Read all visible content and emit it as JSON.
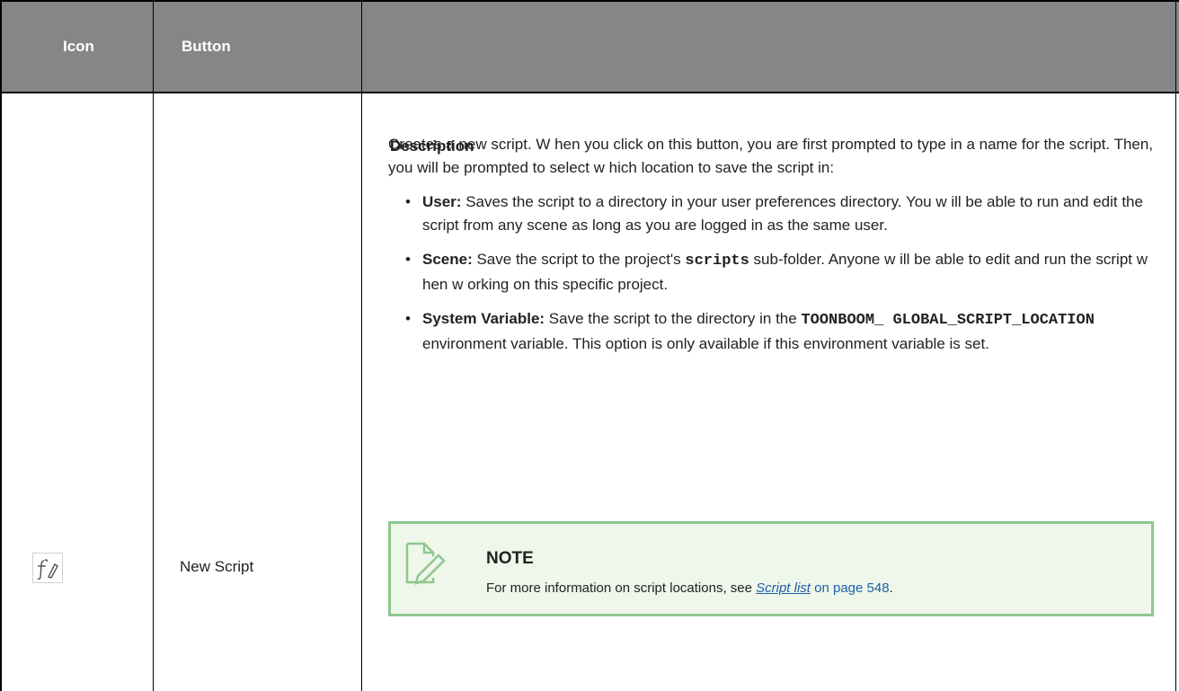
{
  "table": {
    "headers": {
      "icon": "Icon",
      "button": "Button",
      "description": "Description"
    },
    "row": {
      "icon": "function-script-icon",
      "button": "New Script",
      "description": {
        "intro": "Creates a new script. W hen you click on this button, you are first prompted to type in a name for the script. Then, you will be prompted to select w hich location to save the script in:",
        "items": [
          {
            "label": "User:",
            "text": " Saves the script to a directory in your user preferences directory. You w ill be able to run and edit the script from any scene as long as you are logged in as the same user."
          },
          {
            "label": "Scene:",
            "text_before": " Save the script to the project's ",
            "code": "scripts",
            "text_after": " sub-folder. Anyone w ill be able to edit and run the script w hen w orking on this specific project."
          },
          {
            "label": "System Variable:",
            "text_before": " Save the script to the directory in the ",
            "code": "TOONBOOM_ GLOBAL_SCRIPT_LOCATION",
            "text_after": " environment variable. This option is only available if this environment variable is set."
          }
        ]
      },
      "note": {
        "icon": "note-pencil-icon",
        "title": "NOTE",
        "text_before": "For more information on script locations, see ",
        "link_text": "Script list",
        "page_text": " on page 548",
        "text_after": "."
      }
    }
  },
  "colors": {
    "header_bg": "#868686",
    "note_bg": "#eef7ea",
    "note_border": "#8fc78f",
    "link": "#1f5fa8"
  }
}
